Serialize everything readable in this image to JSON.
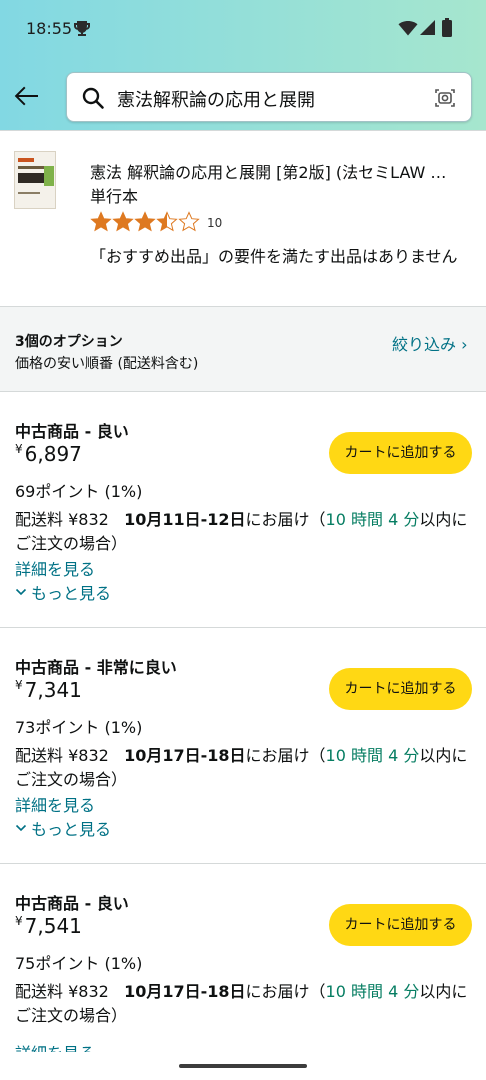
{
  "status_bar": {
    "time": "18:55"
  },
  "search": {
    "query": "憲法解釈論の応用と展開"
  },
  "product": {
    "title": "憲法 解釈論の応用と展開 [第2版] (法セミLAW …",
    "format": "単行本",
    "rating_value": 3.5,
    "rating_count": "10",
    "no_recommended": "「おすすめ出品」の要件を満たす出品はありません"
  },
  "options": {
    "count_label": "3個のオプション",
    "sort_label": "価格の安い順番 (配送料含む)",
    "filter_label": "絞り込み ›"
  },
  "offers": [
    {
      "condition": "中古商品 - 良い",
      "currency": "¥",
      "price": "6,897",
      "points": "69ポイント (1%)",
      "shipping_fee": "配送料 ¥832",
      "delivery_dates": "10月11日-12日",
      "delivery_suffix": "にお届け（",
      "countdown": "10 時間 4 分",
      "countdown_suffix": "以内にご注文の場合）",
      "details_label": "詳細を見る",
      "more_label": "もっと見る",
      "cart_label": "カートに追加する"
    },
    {
      "condition": "中古商品 - 非常に良い",
      "currency": "¥",
      "price": "7,341",
      "points": "73ポイント (1%)",
      "shipping_fee": "配送料 ¥832",
      "delivery_dates": "10月17日-18日",
      "delivery_suffix": "にお届け（",
      "countdown": "10 時間 4 分",
      "countdown_suffix": "以内にご注文の場合）",
      "details_label": "詳細を見る",
      "more_label": "もっと見る",
      "cart_label": "カートに追加する"
    },
    {
      "condition": "中古商品 - 良い",
      "currency": "¥",
      "price": "7,541",
      "points": "75ポイント (1%)",
      "shipping_fee": "配送料 ¥832",
      "delivery_dates": "10月17日-18日",
      "delivery_suffix": "にお届け（",
      "countdown": "10 時間 4 分",
      "countdown_suffix": "以内にご注文の場合）",
      "details_label": "詳細を見る",
      "cart_label": "カートに追加する"
    }
  ],
  "colors": {
    "header_gradient_start": "#82d8e3",
    "header_gradient_end": "#a6e6ce",
    "cart_button": "#ffd814",
    "link": "#007185",
    "countdown_green": "#067d62",
    "star": "#de7921"
  },
  "icons": [
    "trophy-icon",
    "wifi-icon",
    "cell-signal-icon",
    "battery-icon",
    "back-arrow-icon",
    "search-icon",
    "camera-icon",
    "star-icon",
    "chevron-down-icon"
  ]
}
